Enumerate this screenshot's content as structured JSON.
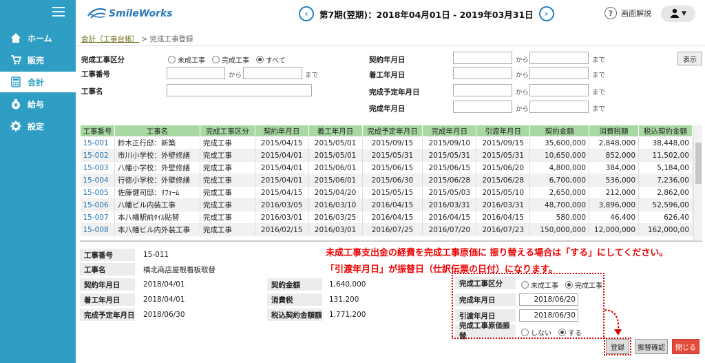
{
  "app": {
    "logo_text": "SmileWorks"
  },
  "sidebar": {
    "items": [
      {
        "label": "ホーム",
        "icon": "home-icon",
        "active": false
      },
      {
        "label": "販売",
        "icon": "cart-icon",
        "active": false
      },
      {
        "label": "会計",
        "icon": "calculator-icon",
        "active": true
      },
      {
        "label": "給与",
        "icon": "yen-bag-icon",
        "active": false
      },
      {
        "label": "設定",
        "icon": "gear-icon",
        "active": false
      }
    ]
  },
  "header": {
    "period": "第7期(翌期)：2018年04月01日 - 2019年03月31日",
    "help_label": "画面解説"
  },
  "breadcrumb": {
    "parent": "会計（工事台帳）",
    "separator": ">",
    "current": "完成工事登録"
  },
  "search": {
    "kubun_label": "完成工事区分",
    "kubun_options": [
      "未成工事",
      "完成工事",
      "すべて"
    ],
    "kubun_selected": 2,
    "kouji_no_label": "工事番号",
    "kouji_name_label": "工事名",
    "from": "から",
    "to": "まで",
    "keiyaku_label": "契約年月日",
    "chakko_label": "着工年月日",
    "kansei_yotei_label": "完成予定年月日",
    "kansei_label": "完成年月日",
    "show_button": "表示"
  },
  "table": {
    "headers": [
      "工事番号",
      "工事名",
      "完成工事区分",
      "契約年月日",
      "着工年月日",
      "完成予定年月日",
      "完成年月日",
      "引渡年月日",
      "契約金額",
      "消費税額",
      "税込契約金額"
    ],
    "rows": [
      [
        "15-001",
        "鈴木正行邸：新築",
        "完成工事",
        "2015/04/15",
        "2015/05/01",
        "2015/09/15",
        "2015/09/10",
        "2015/09/15",
        "35,600,000",
        "2,848,000",
        "38,448,00"
      ],
      [
        "15-002",
        "市川小学校：外壁修繕",
        "完成工事",
        "2015/04/01",
        "2015/05/01",
        "2015/05/31",
        "2015/05/31",
        "2015/05/31",
        "10,650,000",
        "852,000",
        "11,502,00"
      ],
      [
        "15-003",
        "八幡小学校：外壁修繕",
        "完成工事",
        "2015/04/01",
        "2015/06/01",
        "2015/06/15",
        "2015/06/15",
        "2015/06/20",
        "4,800,000",
        "384,000",
        "5,184,00"
      ],
      [
        "15-004",
        "行徳小学校：外壁修繕",
        "完成工事",
        "2015/04/01",
        "2015/06/01",
        "2015/06/30",
        "2015/06/28",
        "2015/06/28",
        "6,700,000",
        "536,000",
        "7,236,00"
      ],
      [
        "15-005",
        "佐藤健司邸：ﾘﾌｫｰﾑ",
        "完成工事",
        "2015/04/15",
        "2015/04/20",
        "2015/05/15",
        "2015/05/03",
        "2015/05/10",
        "2,650,000",
        "212,000",
        "2,862,00"
      ],
      [
        "15-006",
        "八幡ビル内装工事",
        "完成工事",
        "2016/03/05",
        "2016/03/10",
        "2016/04/15",
        "2016/03/31",
        "2016/03/31",
        "48,700,000",
        "3,896,000",
        "52,596,00"
      ],
      [
        "15-007",
        "本八幡駅前ﾀｲﾙ貼替",
        "完成工事",
        "2016/03/01",
        "2016/03/25",
        "2016/04/15",
        "2016/04/15",
        "2016/04/15",
        "580,000",
        "46,400",
        "626,40"
      ],
      [
        "15-008",
        "本八幡ビル内外装工事",
        "完成工事",
        "2016/02/15",
        "2016/03/01",
        "2016/07/25",
        "2016/07/20",
        "2016/07/23",
        "150,000,000",
        "12,000,000",
        "162,000,00"
      ]
    ]
  },
  "detail": {
    "notice_line1": "未成工事支出金の経費を完成工事原価に 振り替える場合は「する」にしてください。",
    "notice_line2": "「引渡年月日」が振替日（仕訳伝票の日付）になります。",
    "kouji_no_label": "工事番号",
    "kouji_no": "15-011",
    "kouji_name_label": "工事名",
    "kouji_name": "橋北商店屋根看板取替",
    "keiyaku_label": "契約年月日",
    "keiyaku": "2018/04/01",
    "chakko_label": "着工年月日",
    "chakko": "2018/04/01",
    "kansei_yotei_label": "完成予定年月日",
    "kansei_yotei": "2018/06/30",
    "kingaku_label": "契約金額",
    "kingaku": "1,640,000",
    "shohizei_label": "消費税",
    "shohizei": "131,200",
    "zeikomi_label": "税込契約金額額",
    "zeikomi": "1,771,200",
    "kubun_label": "完成工事区分",
    "kubun_options": [
      "未成工事",
      "完成工事"
    ],
    "kubun_selected": 1,
    "kansei_label": "完成年月日",
    "kansei": "2018/06/20",
    "hikiwatashi_label": "引渡年月日",
    "hikiwatashi": "2018/06/30",
    "furikae_label": "完成工事原価振替",
    "furikae_options": [
      "しない",
      "する"
    ],
    "furikae_selected": 1,
    "register_button": "登録",
    "confirm_button": "振替確認",
    "close_button": "閉じる"
  }
}
